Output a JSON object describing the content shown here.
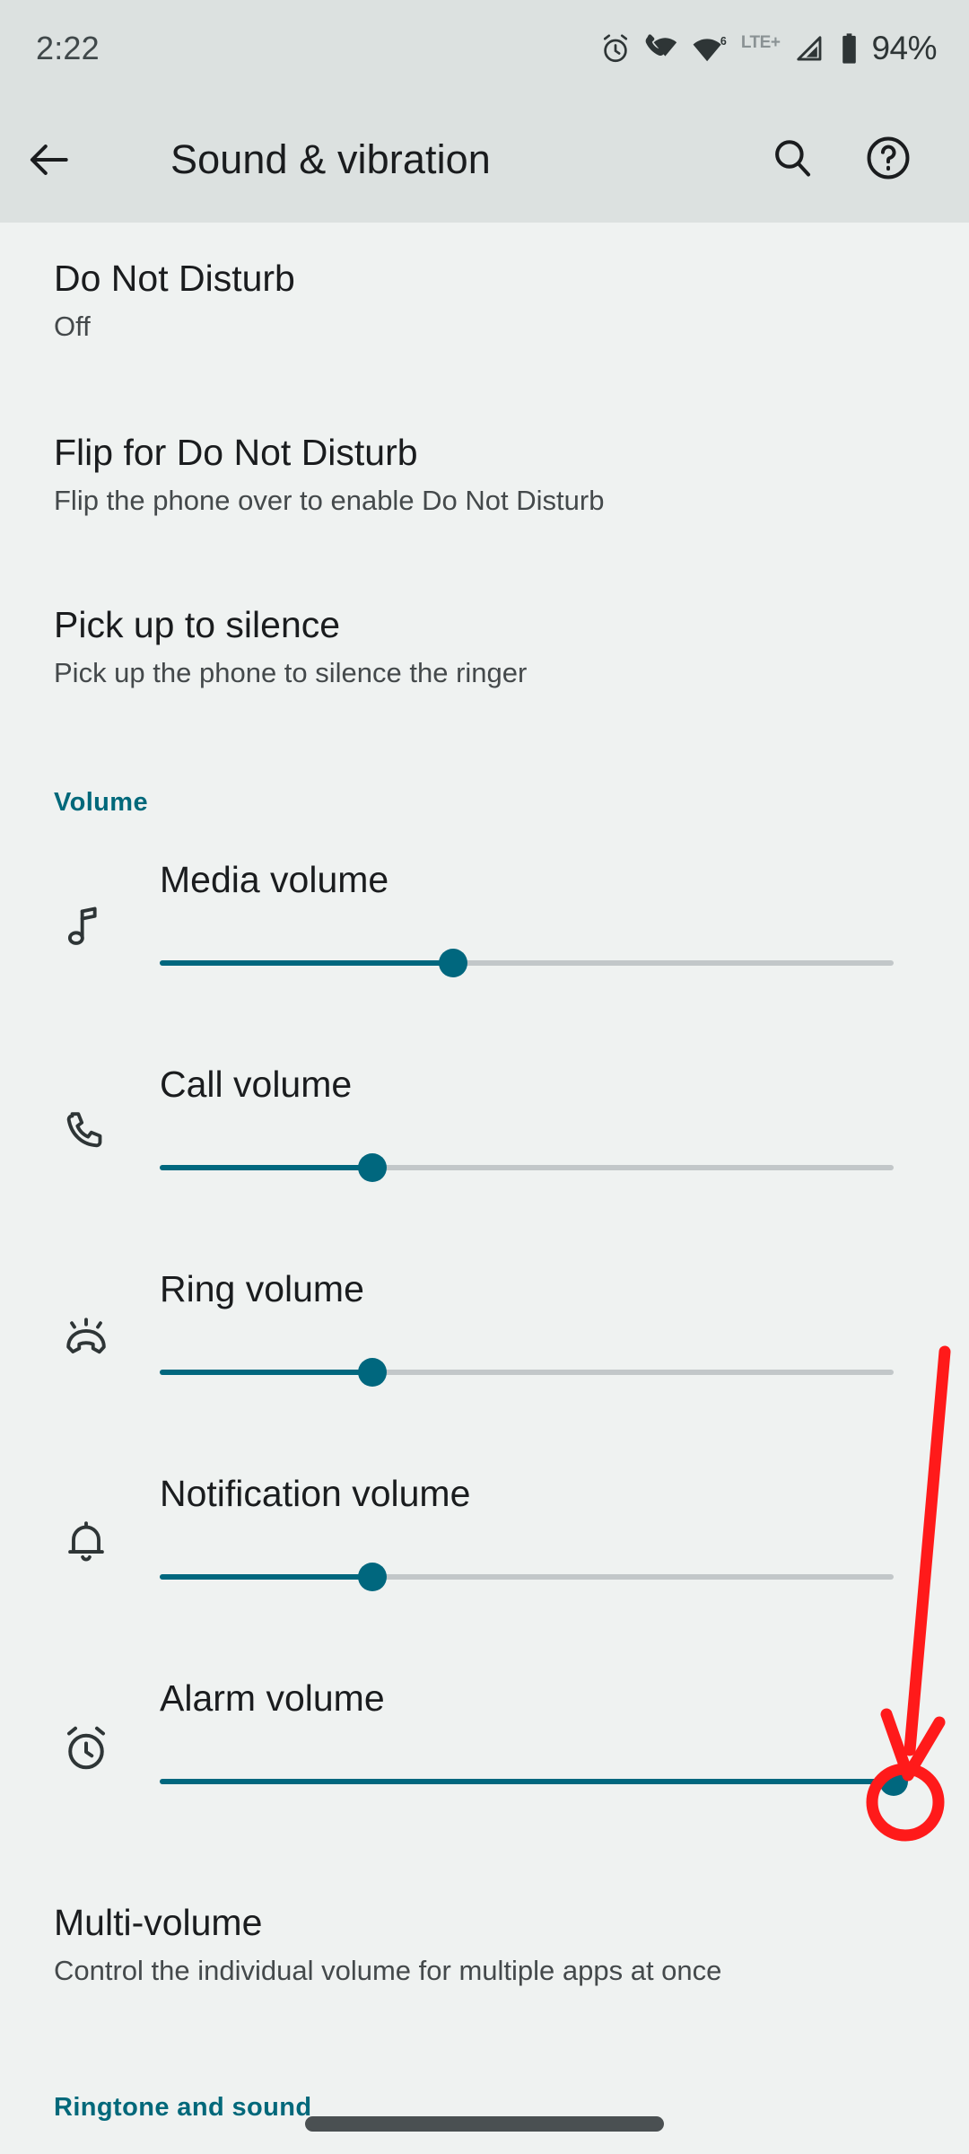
{
  "status_bar": {
    "time": "2:22",
    "icons": [
      "alarm-icon",
      "vowifi-icon",
      "wifi-icon",
      "lte-icon",
      "signal-icon",
      "battery-icon"
    ],
    "network_label": "LTE+",
    "battery_percent": "94%"
  },
  "app_bar": {
    "back_label": "Back",
    "title": "Sound & vibration",
    "search_label": "Search",
    "help_label": "Help"
  },
  "colors": {
    "accent": "#00677E",
    "section_header": "#00687A",
    "track": "#C2C7C9",
    "background": "#EFF2F1",
    "appbar": "#DCE1E0",
    "annotation": "#FF1A1A"
  },
  "preferences": [
    {
      "title": "Do Not Disturb",
      "summary": "Off"
    },
    {
      "title": "Flip for Do Not Disturb",
      "summary": "Flip the phone over to enable Do Not Disturb"
    },
    {
      "title": "Pick up to silence",
      "summary": "Pick up the phone to silence the ringer"
    }
  ],
  "volume_section": {
    "header": "Volume",
    "sliders": [
      {
        "label": "Media volume",
        "icon": "music-note-icon",
        "value": 40,
        "min": 0,
        "max": 100
      },
      {
        "label": "Call volume",
        "icon": "phone-icon",
        "value": 29,
        "min": 0,
        "max": 100
      },
      {
        "label": "Ring volume",
        "icon": "ring-phone-icon",
        "value": 29,
        "min": 0,
        "max": 100
      },
      {
        "label": "Notification volume",
        "icon": "bell-icon",
        "value": 29,
        "min": 0,
        "max": 100
      },
      {
        "label": "Alarm volume",
        "icon": "alarm-clock-icon",
        "value": 100,
        "min": 0,
        "max": 100
      }
    ]
  },
  "multi_volume": {
    "title": "Multi-volume",
    "summary": "Control the individual volume for multiple apps at once"
  },
  "ringtone_section": {
    "header": "Ringtone and sound"
  },
  "annotation": {
    "type": "arrow-and-circle",
    "target": "alarm-volume-slider-thumb",
    "color": "#FF1A1A"
  }
}
